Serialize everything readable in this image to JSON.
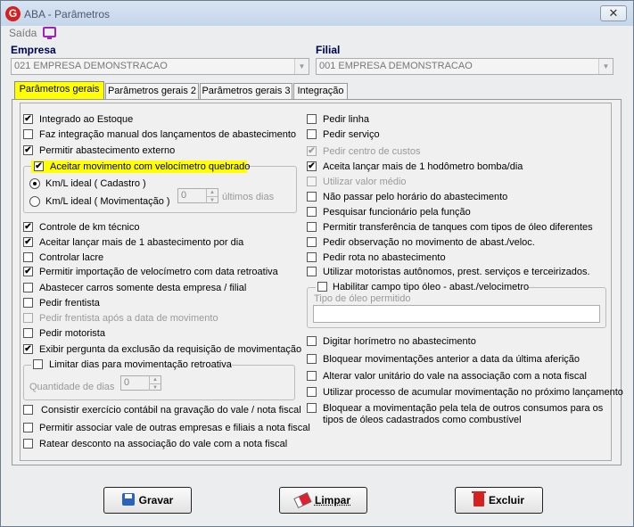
{
  "window": {
    "title": "ABA - Parâmetros",
    "close": "✕"
  },
  "menu": {
    "saida": "Saída"
  },
  "empresa": {
    "label": "Empresa",
    "value": "021 EMPRESA DEMONSTRACAO"
  },
  "filial": {
    "label": "Filial",
    "value": "001 EMPRESA DEMONSTRACAO"
  },
  "tabs": [
    "Parâmetros gerais 1",
    "Parâmetros gerais 2",
    "Parâmetros gerais 3",
    "Integração"
  ],
  "left": {
    "integrado_estoque": "Integrado ao Estoque",
    "faz_integracao": "Faz integração manual dos lançamentos de abastecimento",
    "permitir_abast_externo": "Permitir abastecimento externo",
    "aceitar_velocimetro": "Aceitar movimento com velocímetro quebrado",
    "kml_cadastro": "Km/L ideal ( Cadastro )",
    "kml_movimentacao": "Km/L ideal ( Movimentação )",
    "ultimos_dias_value": "0",
    "ultimos_dias": "últimos dias",
    "controle_km": "Controle de km técnico",
    "aceitar_mais_1": "Aceitar lançar mais de 1 abastecimento por dia",
    "controlar_lacre": "Controlar lacre",
    "permitir_importacao": "Permitir importação de velocímetro com data retroativa",
    "abastecer_carros": "Abastecer carros somente desta empresa / filial",
    "pedir_frentista": "Pedir frentista",
    "pedir_frentista_apos": "Pedir frentista após a data de movimento",
    "pedir_motorista": "Pedir motorista",
    "exibir_pergunta": "Exibir pergunta da exclusão da requisição de movimentação",
    "limitar_dias": "Limitar dias para movimentação retroativa",
    "quantidade_dias": "Quantidade de dias",
    "quantidade_value": "0",
    "consistir_exercicio": "Consistir exercício contábil na gravação do vale / nota fiscal",
    "permitir_associar": "Permitir associar vale de outras empresas e filiais a nota fiscal",
    "ratear_desconto": "Ratear desconto na associação do vale com a nota fiscal"
  },
  "right": {
    "pedir_linha": "Pedir linha",
    "pedir_servico": "Pedir serviço",
    "pedir_centro": "Pedir centro de custos",
    "aceita_hodometro": "Aceita lançar mais de 1 hodômetro bomba/dia",
    "utilizar_valor": "Utilizar valor médio",
    "nao_passar": "Não passar pelo horário do abastecimento",
    "pesquisar_funcionario": "Pesquisar funcionário pela função",
    "permitir_transferencia": "Permitir transferência de tanques com tipos de óleo diferentes",
    "pedir_observacao": "Pedir observação no movimento de abast./veloc.",
    "pedir_rota": "Pedir rota no abastecimento",
    "utilizar_motoristas": "Utilizar motoristas autônomos, prest. serviços e terceirizados.",
    "habilitar_campo": "Habilitar campo tipo óleo - abast./velocimetro",
    "tipo_oleo": "Tipo de óleo permitido",
    "digitar_horimetro": "Digitar horímetro no abastecimento",
    "bloquear_movimentacoes": "Bloquear movimentações anterior a data da última aferição",
    "alterar_valor": "Alterar valor unitário do vale na associação com a nota fiscal",
    "utilizar_processo": "Utilizar processo de acumular movimentação no próximo lançamento",
    "bloquear_tela_1": "Bloquear a movimentação pela tela de outros consumos para os",
    "bloquear_tela_2": "tipos de óleos cadastrados como combustível"
  },
  "buttons": {
    "gravar": "Gravar",
    "limpar": "Limpar",
    "excluir": "Excluir"
  },
  "check_mark": "✔"
}
